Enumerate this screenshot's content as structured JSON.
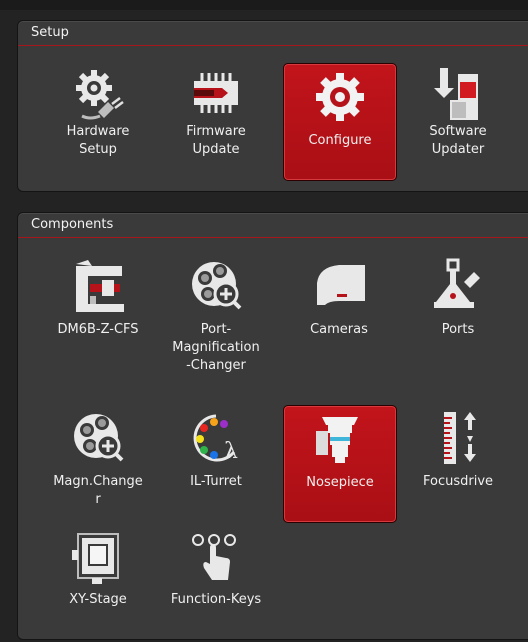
{
  "setup": {
    "title": "Setup",
    "items": [
      {
        "label_lines": [
          "Hardware",
          "Setup"
        ],
        "icon": "gear-plug-icon",
        "active": false
      },
      {
        "label_lines": [
          "Firmware",
          "Update"
        ],
        "icon": "chip-icon",
        "active": false
      },
      {
        "label_lines": [
          "Configure"
        ],
        "icon": "gear-icon",
        "active": true
      },
      {
        "label_lines": [
          "Software",
          "Updater"
        ],
        "icon": "software-update-icon",
        "active": false
      }
    ]
  },
  "components": {
    "title": "Components",
    "items": [
      {
        "label_lines": [
          "DM6B-Z-CFS"
        ],
        "icon": "microscope-icon"
      },
      {
        "label_lines": [
          "Port-",
          "Magnification",
          "-Changer"
        ],
        "icon": "magnification-changer-icon"
      },
      {
        "label_lines": [
          "Cameras"
        ],
        "icon": "camera-icon"
      },
      {
        "label_lines": [
          "Ports"
        ],
        "icon": "ports-icon"
      },
      {
        "label_lines": [
          "Magn.Change",
          "r"
        ],
        "icon": "magnification-changer-icon"
      },
      {
        "label_lines": [
          "IL-Turret"
        ],
        "icon": "filter-turret-icon"
      },
      {
        "label_lines": [
          "Nosepiece"
        ],
        "icon": "nosepiece-icon",
        "active": true
      },
      {
        "label_lines": [
          "Focusdrive"
        ],
        "icon": "focusdrive-icon"
      },
      {
        "label_lines": [
          "XY-Stage"
        ],
        "icon": "xy-stage-icon"
      },
      {
        "label_lines": [
          "Function-Keys"
        ],
        "icon": "function-keys-icon"
      }
    ]
  },
  "colors": {
    "accent": "#b5121a",
    "panel": "#3a3a3a",
    "background": "#232323"
  }
}
